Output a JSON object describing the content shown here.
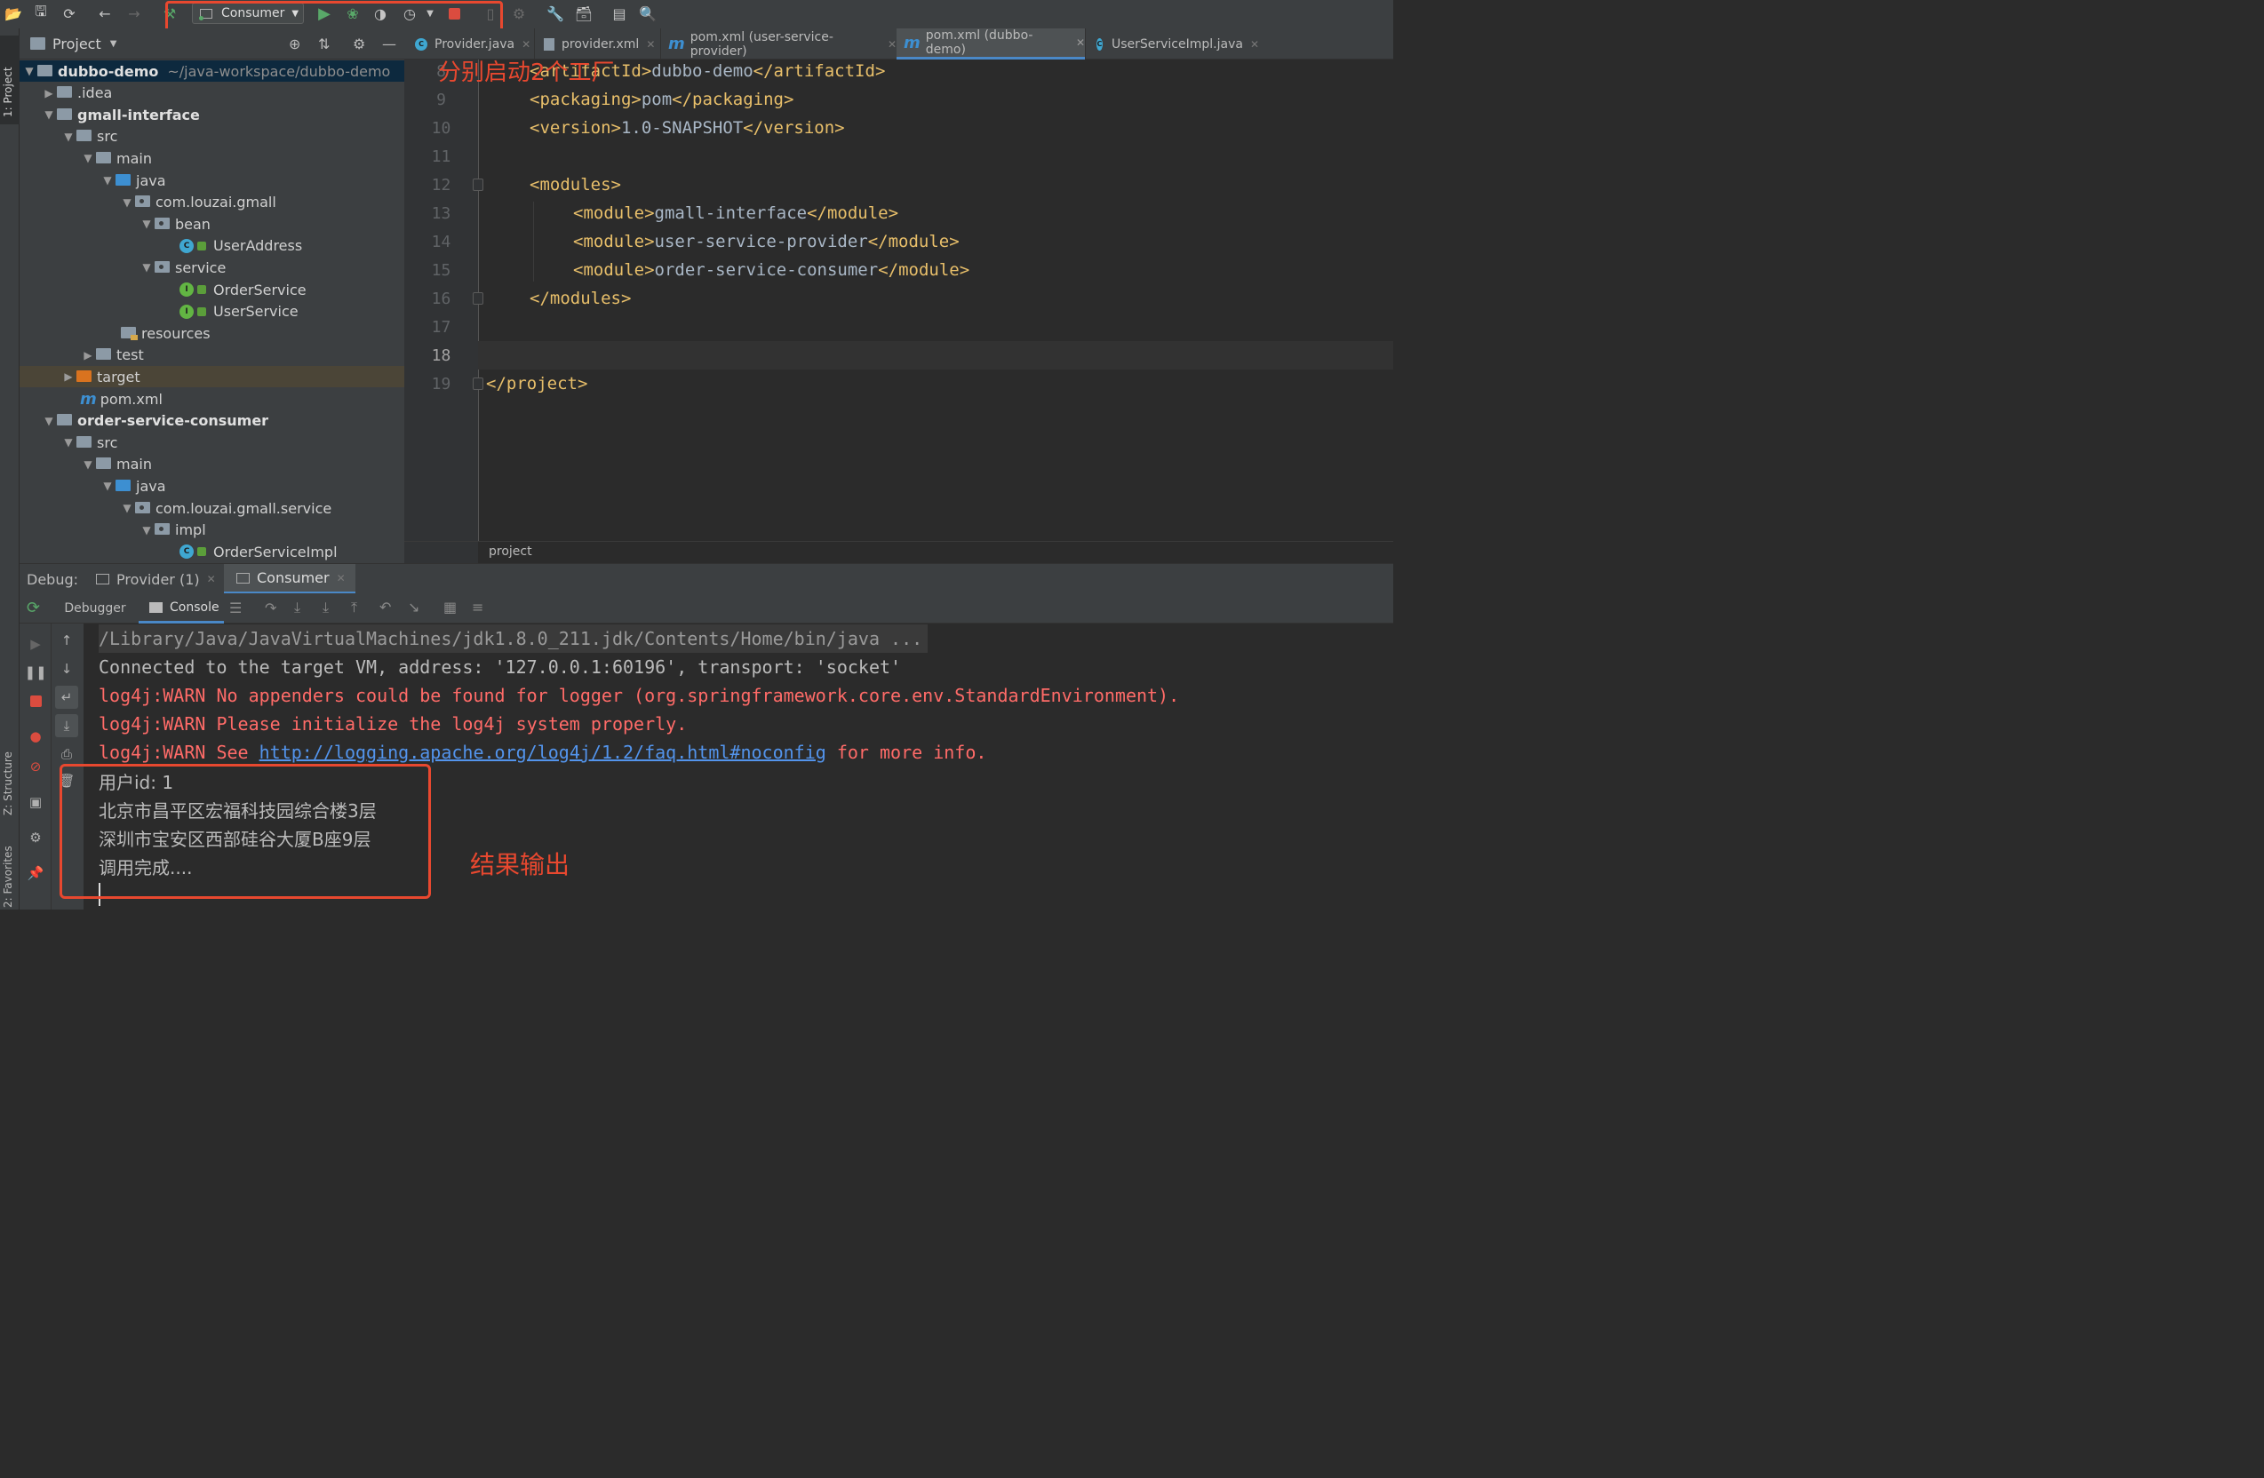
{
  "toolbar": {
    "run_config": "Consumer"
  },
  "left_strip": {
    "project_tab": "1: Project",
    "structure_tab": "Z: Structure",
    "favorites_tab": "2: Favorites"
  },
  "project_panel": {
    "title": "Project",
    "tree": [
      {
        "label": "dubbo-demo",
        "path": "~/java-workspace/dubbo-demo"
      },
      {
        "label": ".idea"
      },
      {
        "label": "gmall-interface"
      },
      {
        "label": "src"
      },
      {
        "label": "main"
      },
      {
        "label": "java"
      },
      {
        "label": "com.louzai.gmall"
      },
      {
        "label": "bean"
      },
      {
        "label": "UserAddress"
      },
      {
        "label": "service"
      },
      {
        "label": "OrderService"
      },
      {
        "label": "UserService"
      },
      {
        "label": "resources"
      },
      {
        "label": "test"
      },
      {
        "label": "target"
      },
      {
        "label": "pom.xml"
      },
      {
        "label": "order-service-consumer"
      },
      {
        "label": "src"
      },
      {
        "label": "main"
      },
      {
        "label": "java"
      },
      {
        "label": "com.louzai.gmall.service"
      },
      {
        "label": "impl"
      },
      {
        "label": "OrderServiceImpl"
      }
    ]
  },
  "editor": {
    "tabs": [
      {
        "label": "Provider.java"
      },
      {
        "label": "provider.xml"
      },
      {
        "label": "pom.xml (user-service-provider)"
      },
      {
        "label": "pom.xml (dubbo-demo)"
      },
      {
        "label": "UserServiceImpl.java"
      }
    ],
    "lines": [
      {
        "num": "8",
        "open": "<artifactId>",
        "text": "dubbo-demo",
        "close": "</artifactId>"
      },
      {
        "num": "9",
        "open": "<packaging>",
        "text": "pom",
        "close": "</packaging>"
      },
      {
        "num": "10",
        "open": "<version>",
        "text": "1.0-SNAPSHOT",
        "close": "</version>"
      },
      {
        "num": "11",
        "open": "",
        "text": "",
        "close": ""
      },
      {
        "num": "12",
        "open": "<modules>",
        "text": "",
        "close": ""
      },
      {
        "num": "13",
        "open": "<module>",
        "text": "gmall-interface",
        "close": "</module>"
      },
      {
        "num": "14",
        "open": "<module>",
        "text": "user-service-provider",
        "close": "</module>"
      },
      {
        "num": "15",
        "open": "<module>",
        "text": "order-service-consumer",
        "close": "</module>"
      },
      {
        "num": "16",
        "open": "</modules>",
        "text": "",
        "close": ""
      },
      {
        "num": "17",
        "open": "",
        "text": "",
        "close": ""
      },
      {
        "num": "18",
        "open": "",
        "text": "",
        "close": ""
      },
      {
        "num": "19",
        "open": "</project>",
        "text": "",
        "close": ""
      }
    ],
    "breadcrumb": "project"
  },
  "annotations": {
    "top": "分别启动2个工厂",
    "result": "结果输出"
  },
  "debug": {
    "label": "Debug:",
    "sessions": [
      {
        "label": "Provider (1)"
      },
      {
        "label": "Consumer"
      }
    ],
    "subtabs": [
      {
        "label": "Debugger"
      },
      {
        "label": "Console"
      }
    ],
    "console": [
      {
        "text": "/Library/Java/JavaVirtualMachines/jdk1.8.0_211.jdk/Contents/Home/bin/java ..."
      },
      {
        "text": "Connected to the target VM, address: '127.0.0.1:60196', transport: 'socket'"
      },
      {
        "text": "log4j:WARN No appenders could be found for logger (org.springframework.core.env.StandardEnvironment)."
      },
      {
        "text": "log4j:WARN Please initialize the log4j system properly."
      },
      {
        "pre": "log4j:WARN See ",
        "link": "http://logging.apache.org/log4j/1.2/faq.html#noconfig",
        "post": " for more info."
      },
      {
        "text": "用户id: 1"
      },
      {
        "text": "北京市昌平区宏福科技园综合楼3层"
      },
      {
        "text": "深圳市宝安区西部硅谷大厦B座9层"
      },
      {
        "text": "调用完成...."
      }
    ]
  },
  "colors": {
    "annotation_red": "#e8482f",
    "warn_red": "#ff6b68",
    "link_blue": "#5394ec",
    "tag_yellow": "#e8bf6a",
    "run_green": "#59a869"
  }
}
